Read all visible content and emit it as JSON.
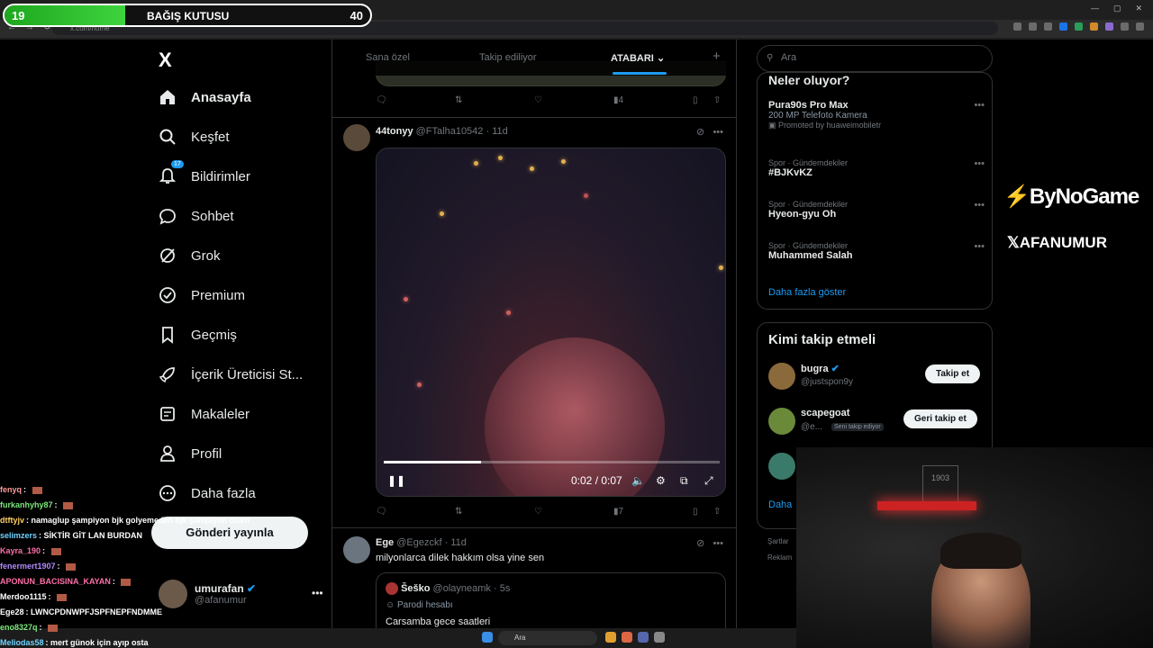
{
  "donation": {
    "level_left": "19",
    "title": "BAĞIŞ KUTUSU",
    "level_right": "40",
    "progress_percent": 33
  },
  "browser": {
    "url": "x.com/home"
  },
  "nav": {
    "logo": "X",
    "items": [
      {
        "label": "Anasayfa",
        "icon": "home-icon"
      },
      {
        "label": "Keşfet",
        "icon": "search-icon"
      },
      {
        "label": "Bildirimler",
        "icon": "bell-icon",
        "badge": "17"
      },
      {
        "label": "Sohbet",
        "icon": "chat-icon"
      },
      {
        "label": "Grok",
        "icon": "grok-icon"
      },
      {
        "label": "Premium",
        "icon": "premium-icon"
      },
      {
        "label": "Geçmiş",
        "icon": "bookmark-icon"
      },
      {
        "label": "İçerik Üreticisi St...",
        "icon": "rocket-icon"
      },
      {
        "label": "Makaleler",
        "icon": "article-icon"
      },
      {
        "label": "Profil",
        "icon": "person-icon"
      },
      {
        "label": "Daha fazla",
        "icon": "more-icon"
      }
    ],
    "post_button": "Gönderi yayınla",
    "me": {
      "name": "umurafan",
      "handle": "@afanumur"
    }
  },
  "chat": [
    {
      "user": "fenyq",
      "text": "",
      "color": "#ff9b9b"
    },
    {
      "user": "furkanhyhy87",
      "text": "",
      "color": "#7ce87c"
    },
    {
      "user": "dtftyjv",
      "text": "namaglup şampiyon bjk golyemeden bjk şampiyon olurrr",
      "color": "#ffd166"
    },
    {
      "user": "selimzers",
      "text": "SİKTİR GİT LAN BURDAN",
      "color": "#6fd3ff"
    },
    {
      "user": "Kayra_190",
      "text": "",
      "color": "#ff6fa8"
    },
    {
      "user": "fenermert1907",
      "text": "",
      "color": "#b388ff"
    },
    {
      "user": "APONUN_BACISINA_KAYAN",
      "text": "",
      "color": "#ff6fa8"
    },
    {
      "user": "Merdoo1115",
      "text": "",
      "color": "#ffffff"
    },
    {
      "user": "Ege28",
      "text": "LWNCPDNWPFJSPFNEPFNDMME",
      "color": "#ffffff"
    },
    {
      "user": "eno8327q",
      "text": "",
      "color": "#7ce87c"
    },
    {
      "user": "Meliodas58",
      "text": "mert günok için ayıp osta",
      "color": "#6fd3ff"
    }
  ],
  "tabs": [
    "Sana özel",
    "Takip ediliyor",
    "ATABARI"
  ],
  "prev_tweet": {
    "views": "4"
  },
  "tweet1": {
    "name": "44tonyy",
    "handle": "@FTalha10542",
    "time": "11d",
    "video_time": "0:02 / 0:07",
    "video_progress": 0.29,
    "views": "7"
  },
  "tweet2": {
    "name": "Ege",
    "handle": "@Egezckf",
    "time": "11d",
    "text": "milyonlarca dilek hakkım olsa yine sen",
    "quote": {
      "name": "Šeško",
      "handle": "@olayneamk",
      "time": "5s",
      "label": "Parodi hesabı",
      "text": "Carsamba gece saatleri"
    }
  },
  "right": {
    "search_placeholder": "Ara",
    "trends_title": "Neler oluyor?",
    "trends": [
      {
        "meta": "",
        "name": "Pura90s Pro Max",
        "sub": "200 MP Telefoto Kamera",
        "promo": "Promoted by huaweimobiletr"
      },
      {
        "meta": "Spor · Gündemdekiler",
        "name": "#BJKvKZ"
      },
      {
        "meta": "Spor · Gündemdekiler",
        "name": "Hyeon-gyu Oh"
      },
      {
        "meta": "Spor · Gündemdekiler",
        "name": "Muhammed Salah"
      }
    ],
    "show_more": "Daha fazla göster",
    "wtf_title": "Kimi takip etmeli",
    "wtf": [
      {
        "name": "bugra",
        "handle": "@justspon9y",
        "button": "Takip et"
      },
      {
        "name": "scapegoat",
        "handle": "@e...",
        "tag": "Seni takip ediyor",
        "button": "Geri takip et"
      }
    ],
    "wtf_more": "Daha",
    "legal": [
      "Şartlar",
      "Reklam"
    ]
  },
  "brands": {
    "bynogame": "ByNoGame",
    "afanumur": "AFANUMUR"
  },
  "cam": {
    "sign": "1903"
  },
  "taskbar": {
    "search": "Ara"
  }
}
